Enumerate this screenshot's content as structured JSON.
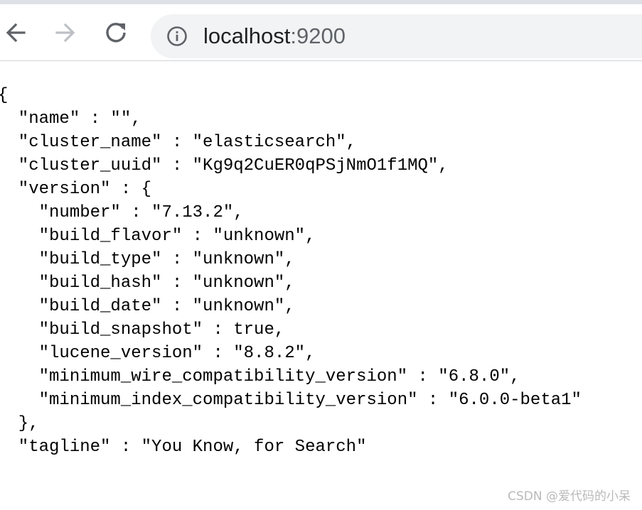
{
  "browser": {
    "url_host": "localhost",
    "url_port": ":9200",
    "icons": {
      "back": "arrow-left-icon",
      "forward": "arrow-right-icon",
      "reload": "reload-icon",
      "site_info": "info-circle-icon"
    }
  },
  "json_lines": [
    "{",
    "  \"name\" : \"\",",
    "  \"cluster_name\" : \"elasticsearch\",",
    "  \"cluster_uuid\" : \"Kg9q2CuER0qPSjNmO1f1MQ\",",
    "  \"version\" : {",
    "    \"number\" : \"7.13.2\",",
    "    \"build_flavor\" : \"unknown\",",
    "    \"build_type\" : \"unknown\",",
    "    \"build_hash\" : \"unknown\",",
    "    \"build_date\" : \"unknown\",",
    "    \"build_snapshot\" : true,",
    "    \"lucene_version\" : \"8.8.2\",",
    "    \"minimum_wire_compatibility_version\" : \"6.8.0\",",
    "    \"minimum_index_compatibility_version\" : \"6.0.0-beta1\"",
    "  },",
    "  \"tagline\" : \"You Know, for Search\""
  ],
  "watermark": "CSDN @爱代码的小呆",
  "colors": {
    "toolbar_icon": "#5f6368",
    "toolbar_icon_disabled": "#bdc1c6",
    "omnibox_bg": "#f1f3f4",
    "text": "#000000"
  }
}
